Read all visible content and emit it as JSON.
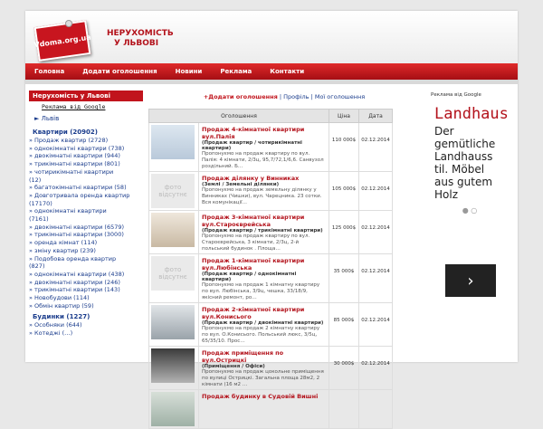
{
  "header": {
    "logo_text": "Vdoma.org.ua",
    "title_line1": "НЕРУХОМІСТЬ",
    "title_line2": "У ЛЬВОВІ"
  },
  "nav": [
    {
      "label": "Головна"
    },
    {
      "label": "Додати оголошення"
    },
    {
      "label": "Новини"
    },
    {
      "label": "Реклама"
    },
    {
      "label": "Контакти"
    }
  ],
  "sidebar": {
    "head": "Нерухомість у Львові",
    "ad_link": "Реклама від Google",
    "lviv": "► Львів",
    "sections": [
      {
        "title": "Квартири (20902)",
        "items": [
          "» Продаж квартир (2728)",
          "» однокімнатні квартири (738)",
          "» двокімнатні квартири (944)",
          "» трикімнатні квартири (801)",
          "» чотирикімнатні квартири",
          "(12)",
          "» багатокімнатні квартири (58)",
          "» Довготривала оренда квартир",
          "(17170)",
          "» однокімнатні квартири",
          "(7161)",
          "» двокімнатні квартири (6579)",
          "» трикімнатні квартири (3000)",
          "» оренда кімнат (114)",
          "» зміну квартир (239)",
          "» Подобова оренда квартир",
          "(827)",
          "» однокімнатні квартири (438)",
          "» двокімнатні квартири (246)",
          "» трикімнатні квартири (143)",
          "» Новобудови (114)",
          "» Обмін квартир (59)"
        ]
      },
      {
        "title": "Будинки (1227)",
        "items": [
          "» Особняки (644)",
          "» Котеджі (…)"
        ]
      }
    ]
  },
  "main": {
    "add_link": "+Додати оголошення",
    "sep1": "|",
    "profile_link": "Профіль",
    "sep2": "|",
    "my_ads_link": "Мої оголошення",
    "columns": [
      "Оголошення",
      "Ціна",
      "Дата"
    ],
    "listings": [
      {
        "thumb": "",
        "title": "Продаж 4-кімнатної квартири вул.Палія",
        "category": "(Продаж квартир / чотирикімнатні квартири)",
        "desc": "Пропонуємо на продаж квартиру по вул. Палія: 4 кімнати, 2/3ц, 95,7/72,1/6,6. Санвузол роздільний. Б…",
        "price": "110 000$",
        "date": "02.12.2014"
      },
      {
        "thumb": "фото відсутнє",
        "title": "Продаж ділянку у Винниках",
        "category": "(Землі / Земельні ділянки)",
        "desc": "Пропонуємо на продаж земельну ділянку у Винниках (Чишки), вул. Чарецника. 23 сотки. Вся комунікації…",
        "price": "105 000$",
        "date": "02.12.2014"
      },
      {
        "thumb": "",
        "title": "Продаж 3-кімнатної квартири вул.Староєврейська",
        "category": "(Продаж квартир / трикімнатні квартири)",
        "desc": "Пропонуємо на продаж квартиру по вул. Староєврейська, 3 кімнати, 2/3ц, 2-й польський будинок . Площа…",
        "price": "125 000$",
        "date": "02.12.2014"
      },
      {
        "thumb": "фото відсутнє",
        "title": "Продаж 1-кімнатної квартири вул.Любінська",
        "category": "(Продаж квартир / однокімнатні квартири)",
        "desc": "Пропонуємо на продаж 1 кімнатну квартиру по вул. Любінська, 3/9ц, чешка, 33/18/9, якісний ремонт, ро…",
        "price": "35 000$",
        "date": "02.12.2014"
      },
      {
        "thumb": "",
        "title": "Продаж 2-кімнатної квартири вул.Конисього",
        "category": "(Продаж квартир / двокімнатні квартири)",
        "desc": "Пропонуємо на продаж 2 кімнатну квартиру по вул. О.Конисього. Польський люкс, 3/5ц, 65/35/10. Прос…",
        "price": "85 000$",
        "date": "02.12.2014"
      },
      {
        "thumb": "",
        "title": "Продаж приміщення по вул.Острицкі",
        "category": "(Приміщення / Офіси)",
        "desc": "Пропонуємо на продаж цокольне приміщення по вулиці Острицкі. Загальна площа 28м2, 2 кімнати (16 м2 …",
        "price": "30 000$",
        "date": "02.12.2014"
      },
      {
        "thumb": "",
        "title": "Продаж будинку в Судовій Вишні",
        "category": "",
        "desc": "",
        "price": "",
        "date": ""
      }
    ]
  },
  "ad": {
    "by": "Реклама від Google",
    "title": "Landhaus",
    "body": "Der gemütliche Landhauss til. Möbel aus gutem Holz",
    "dots": "● ○",
    "arrow": "›"
  }
}
